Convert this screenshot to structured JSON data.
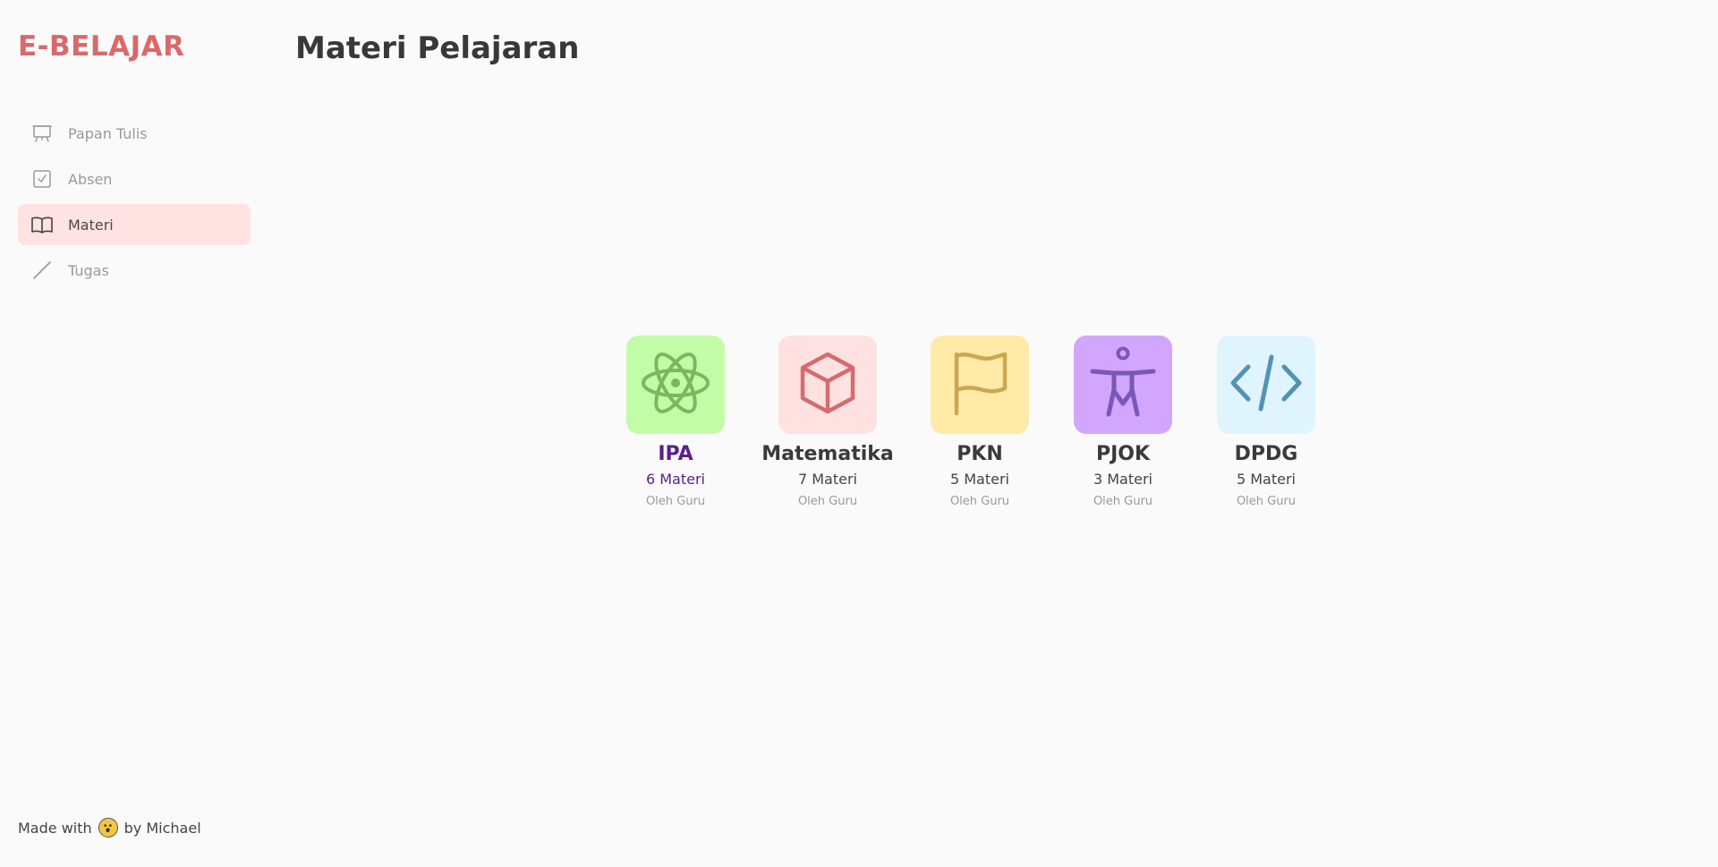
{
  "app": {
    "logo": "E-BELAJAR"
  },
  "sidebar": {
    "items": [
      {
        "label": "Papan Tulis",
        "icon": "presentation-board-icon",
        "active": false
      },
      {
        "label": "Absen",
        "icon": "checkbox-icon",
        "active": false
      },
      {
        "label": "Materi",
        "icon": "open-book-icon",
        "active": true
      },
      {
        "label": "Tugas",
        "icon": "pencil-icon",
        "active": false
      }
    ]
  },
  "footer": {
    "prefix": "Made with",
    "suffix": "by Michael",
    "emoji_icon": "emoji-face-icon"
  },
  "main": {
    "title": "Materi Pelajaran"
  },
  "subjects": [
    {
      "name": "IPA",
      "count": "6 Materi",
      "author": "Oleh Guru",
      "icon": "atom-icon",
      "tile_color": "#c3fca6",
      "icon_color": "#7ab860",
      "selected": true
    },
    {
      "name": "Matematika",
      "count": "7 Materi",
      "author": "Oleh Guru",
      "icon": "cube-icon",
      "tile_color": "#ffe1e1",
      "icon_color": "#d56b6d",
      "selected": false
    },
    {
      "name": "PKN",
      "count": "5 Materi",
      "author": "Oleh Guru",
      "icon": "flag-icon",
      "tile_color": "#ffeaa8",
      "icon_color": "#c9a852",
      "selected": false
    },
    {
      "name": "PJOK",
      "count": "3 Materi",
      "author": "Oleh Guru",
      "icon": "accessibility-person-icon",
      "tile_color": "#d2a6fc",
      "icon_color": "#7a57b8",
      "selected": false
    },
    {
      "name": "DPDG",
      "count": "5 Materi",
      "author": "Oleh Guru",
      "icon": "code-icon",
      "tile_color": "#e0f4fd",
      "icon_color": "#5293b5",
      "selected": false
    }
  ]
}
